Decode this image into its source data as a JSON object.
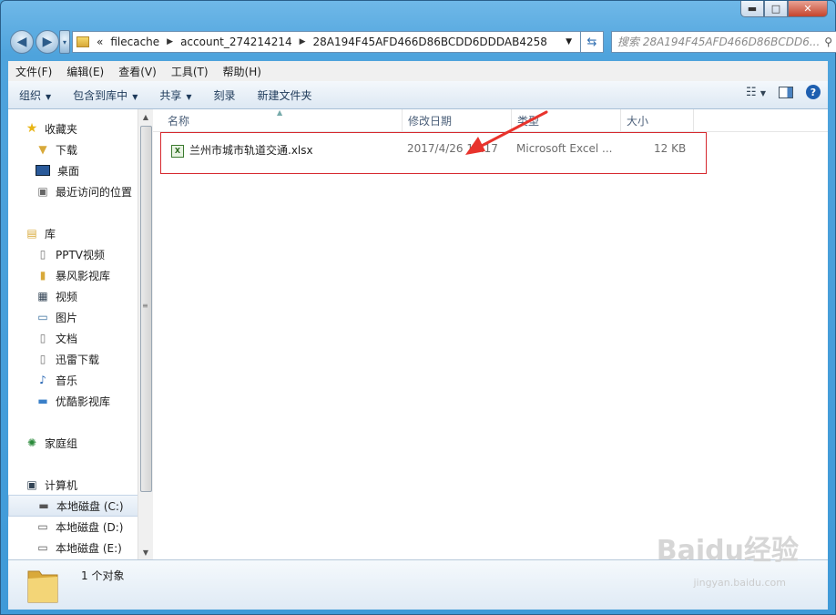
{
  "window": {
    "minimize_glyph": "▬",
    "maximize_glyph": "□",
    "close_glyph": "✕"
  },
  "address": {
    "chevron": "«",
    "segments": [
      "filecache",
      "account_274214214",
      "28A194F45AFD466D86BCDD6DDDAB4258"
    ],
    "search_placeholder": "搜索 28A194F45AFD466D86BCDD6..."
  },
  "menubar": [
    "文件(F)",
    "编辑(E)",
    "查看(V)",
    "工具(T)",
    "帮助(H)"
  ],
  "toolbar": {
    "organize": "组织",
    "include_library": "包含到库中",
    "share": "共享",
    "burn": "刻录",
    "new_folder": "新建文件夹"
  },
  "sidebar": {
    "favorites": {
      "title": "收藏夹",
      "items": [
        "下载",
        "桌面",
        "最近访问的位置"
      ]
    },
    "libraries": {
      "title": "库",
      "items": [
        "PPTV视频",
        "暴风影视库",
        "视频",
        "图片",
        "文档",
        "迅雷下载",
        "音乐",
        "优酷影视库"
      ]
    },
    "homegroup": "家庭组",
    "computer": {
      "title": "计算机",
      "items": [
        "本地磁盘 (C:)",
        "本地磁盘 (D:)",
        "本地磁盘 (E:)"
      ]
    }
  },
  "columns": [
    "名称",
    "修改日期",
    "类型",
    "大小"
  ],
  "files": [
    {
      "name": "兰州市城市轨道交通.xlsx",
      "modified": "2017/4/26 15:17",
      "type": "Microsoft Excel ...",
      "size": "12 KB"
    }
  ],
  "status": {
    "count_text": "1 个对象"
  },
  "watermark": {
    "brand": "Baidu经验",
    "url": "jingyan.baidu.com"
  },
  "colors": {
    "highlight_box": "#d6282e",
    "annotation_arrow": "#e8332c"
  }
}
